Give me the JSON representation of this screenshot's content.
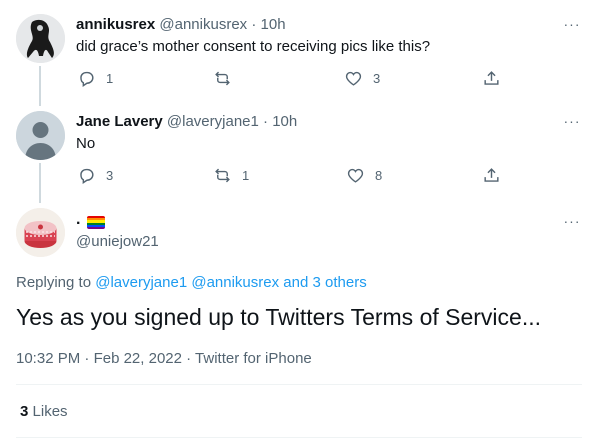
{
  "tweets": [
    {
      "name": "annikusrex",
      "handle": "@annikusrex",
      "sep": "·",
      "time": "10h",
      "text": "did grace’s mother consent to receiving pics like this?",
      "replies": "1",
      "retweets": "",
      "likes": "3"
    },
    {
      "name": "Jane Lavery",
      "handle": "@laveryjane1",
      "sep": "·",
      "time": "10h",
      "text": "No",
      "replies": "3",
      "retweets": "1",
      "likes": "8"
    }
  ],
  "main": {
    "name": ".",
    "flag_colors": [
      "#e40303",
      "#ff8c00",
      "#ffed00",
      "#008026",
      "#004dff",
      "#750787"
    ],
    "handle": "@uniejow21",
    "replying_prefix": "Replying to",
    "reply_to_1": "@laveryjane1",
    "reply_to_2": "@annikusrex",
    "reply_to_others": "and 3 others",
    "text": "Yes as you signed up to Twitters Terms of Service...",
    "time": "10:32 PM",
    "date": "Feb 22, 2022",
    "client": "Twitter for iPhone",
    "meta_sep": "·",
    "likes_count": "3",
    "likes_label": "Likes"
  },
  "more_glyph": "···",
  "icons": [
    "reply-icon",
    "retweet-icon",
    "like-icon",
    "share-icon",
    "more-icon"
  ]
}
